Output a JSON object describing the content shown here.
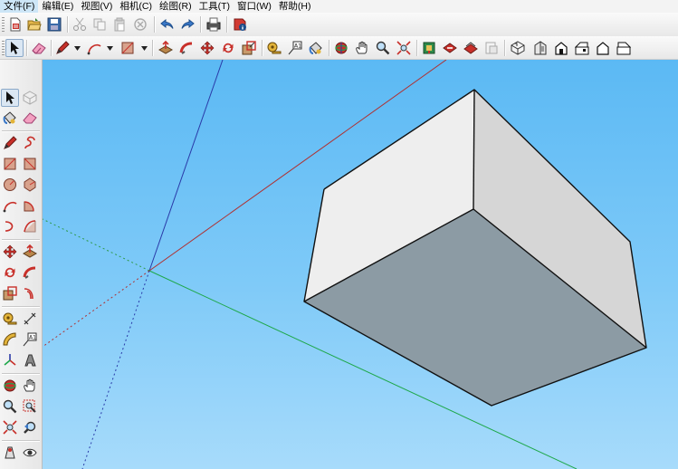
{
  "menu": [
    "文件(F)",
    "编辑(E)",
    "视图(V)",
    "相机(C)",
    "绘图(R)",
    "工具(T)",
    "窗口(W)",
    "帮助(H)"
  ],
  "colors": {
    "sky_top": "#5bb9f4",
    "sky_bottom": "#a7dbfb",
    "axis_red": "#b03030",
    "axis_green": "#1ea84a",
    "axis_blue": "#2a3aa8",
    "box_front": "#eeeeee",
    "box_side": "#d7d7d7",
    "box_bottom": "#8c9ba4",
    "accent_red": "#c8302a"
  },
  "toolbar1": [
    "new-file-icon",
    "open-file-icon",
    "save-icon",
    "cut-icon",
    "copy-icon",
    "paste-icon",
    "erase-icon",
    "undo-icon",
    "redo-icon",
    "print-icon",
    "model-info-icon"
  ],
  "toolbar2": [
    "select-icon",
    "eraser-icon",
    "pencil-icon",
    "arc-icon",
    "rectangle-icon",
    "push-pull-icon",
    "follow-me-icon",
    "move-icon",
    "rotate-icon",
    "scale-icon",
    "tape-measure-icon",
    "text-icon",
    "paint-bucket-icon",
    "orbit-icon",
    "pan-icon",
    "zoom-icon",
    "zoom-extents-icon",
    "get-models-icon",
    "share-model-icon",
    "share-component-icon",
    "send-to-layout-icon",
    "iso-view-icon",
    "top-view-icon",
    "front-view-icon",
    "right-view-icon",
    "back-view-icon",
    "left-view-icon"
  ],
  "left_toolbar": [
    "select-icon",
    "make-component-icon",
    "paint-bucket-icon",
    "eraser-icon",
    "line-icon",
    "freehand-icon",
    "rectangle-icon",
    "rotated-rectangle-icon",
    "circle-icon",
    "polygon-icon",
    "arc-icon",
    "pie-icon",
    "move-icon",
    "push-pull-icon",
    "rotate-icon",
    "follow-me-icon",
    "scale-icon",
    "offset-icon",
    "tape-measure-icon",
    "dimension-icon",
    "protractor-icon",
    "text-icon",
    "axes-icon",
    "3d-text-icon",
    "orbit-icon",
    "pan-icon",
    "zoom-icon",
    "zoom-window-icon",
    "zoom-extents-icon",
    "previous-view-icon",
    "position-camera-icon",
    "look-around-icon"
  ]
}
